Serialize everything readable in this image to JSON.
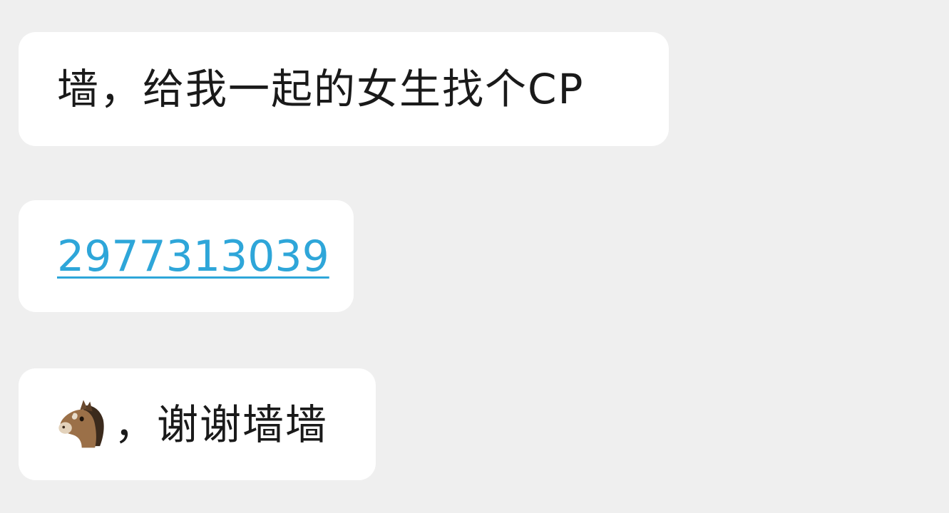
{
  "messages": [
    {
      "text": "墙，给我一起的女生找个CP"
    },
    {
      "link": "2977313039",
      "link_color": "#2ea6d9"
    },
    {
      "emoji": "horse-face-icon",
      "text": "，谢谢墙墙"
    }
  ],
  "colors": {
    "background": "#efefef",
    "bubble": "#ffffff",
    "text": "#1a1a1a"
  }
}
